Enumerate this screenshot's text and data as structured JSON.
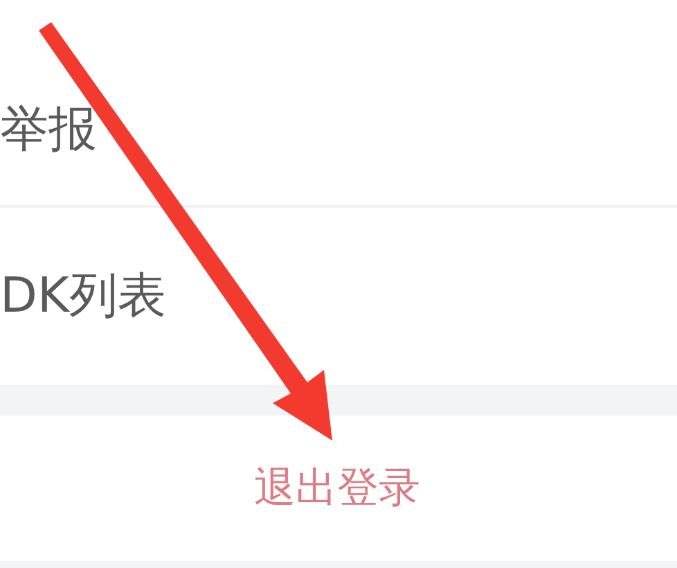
{
  "settings_items": [
    {
      "label": "举报"
    },
    {
      "label": "DK列表"
    }
  ],
  "logout_button": {
    "label": "退出登录"
  }
}
